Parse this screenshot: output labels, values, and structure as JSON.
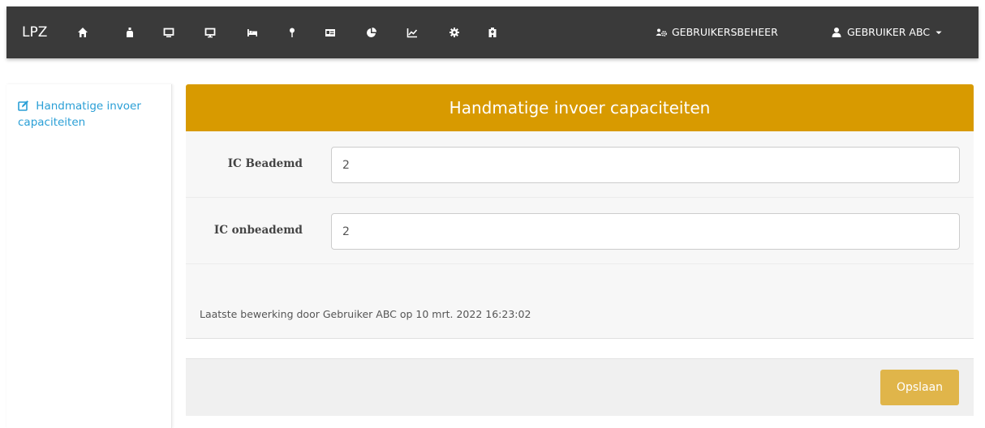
{
  "navbar": {
    "brand": "LPZ",
    "icons": [
      "home-icon",
      "bottle-icon",
      "monitor-icon",
      "monitor-alt-icon",
      "bed-icon",
      "pin-icon",
      "id-card-icon",
      "pie-chart-icon",
      "line-chart-icon",
      "gear-icon",
      "hospital-icon"
    ],
    "user_management_label": "GEBRUIKERSBEHEER",
    "user_label": "GEBRUIKER ABC"
  },
  "sidebar": {
    "items": [
      {
        "label": "Handmatige invoer capaciteiten",
        "icon": "edit-icon"
      }
    ]
  },
  "panel": {
    "title": "Handmatige invoer capaciteiten",
    "fields": [
      {
        "label": "IC Beademd",
        "value": "2"
      },
      {
        "label": "IC onbeademd",
        "value": "2"
      }
    ],
    "last_edit": "Laatste bewerking door Gebruiker ABC op 10 mrt. 2022 16:23:02",
    "save_label": "Opslaan"
  },
  "colors": {
    "navbar_bg": "#3a3a3a",
    "header_bg": "#d89a00",
    "link": "#2a9fd6",
    "save_button": "#e0b54a"
  }
}
